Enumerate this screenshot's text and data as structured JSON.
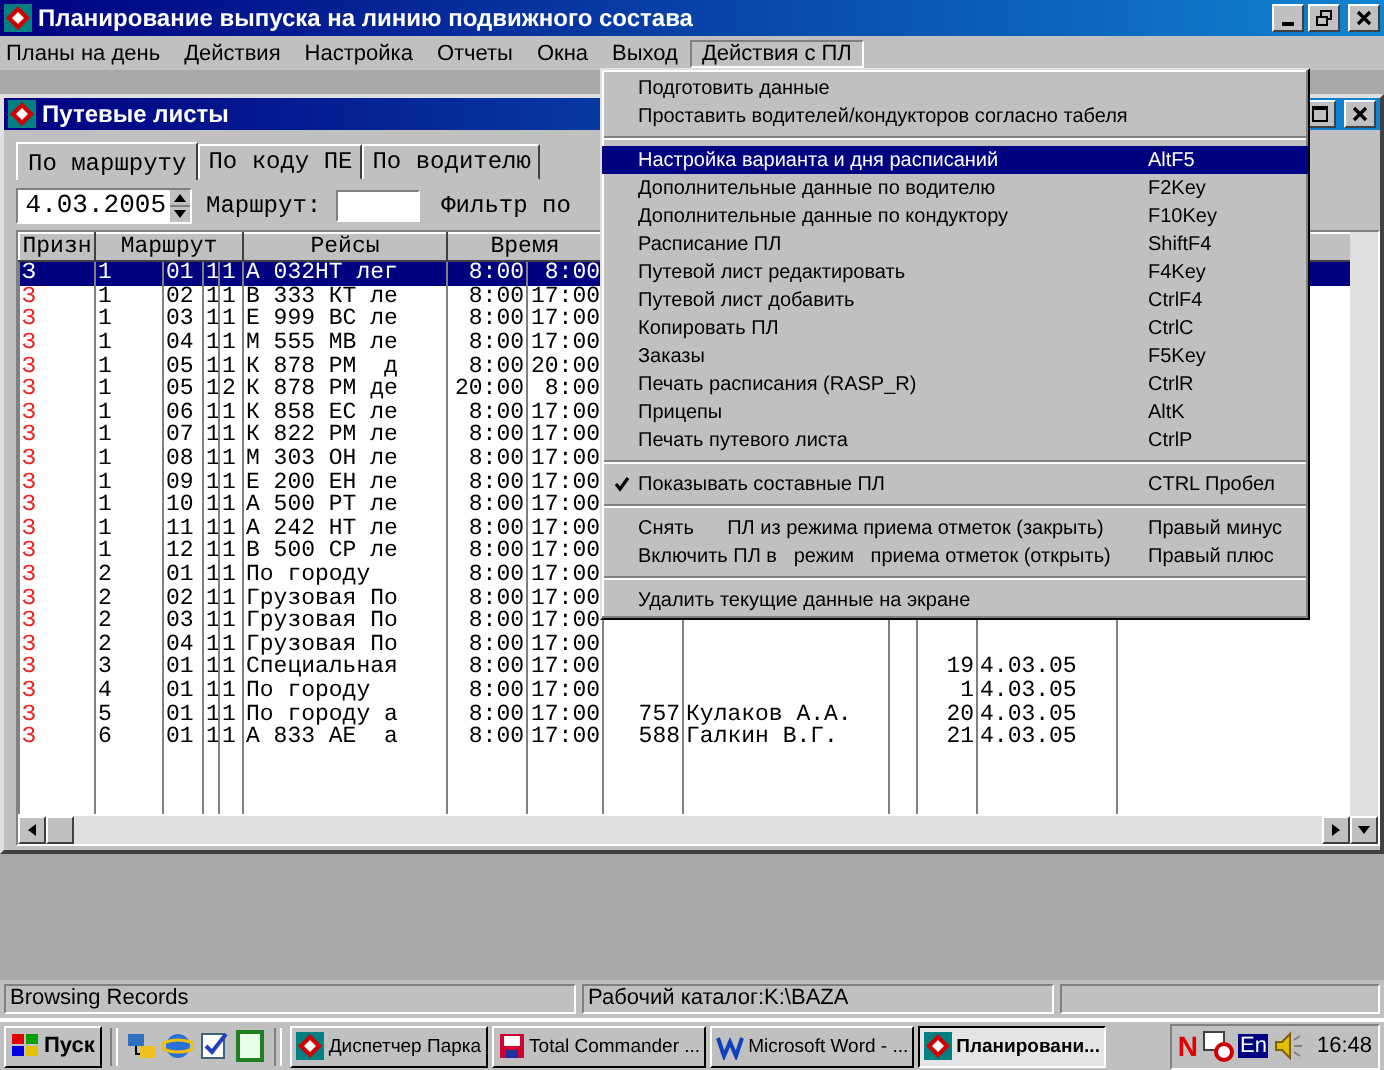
{
  "window": {
    "title": "Планирование выпуска на линию подвижного состава"
  },
  "menu_bar": [
    {
      "label": "Планы на день",
      "selected": false
    },
    {
      "label": "Действия",
      "selected": false
    },
    {
      "label": "Настройка",
      "selected": false
    },
    {
      "label": "Отчеты",
      "selected": false
    },
    {
      "label": "Окна",
      "selected": false
    },
    {
      "label": "Выход",
      "selected": false
    },
    {
      "label": "Действия с ПЛ",
      "selected": true
    }
  ],
  "child_window": {
    "title": "Путевые листы"
  },
  "tabs": [
    {
      "label": "По маршруту",
      "selected": true
    },
    {
      "label": "По коду ПЕ",
      "selected": false
    },
    {
      "label": "По водителю",
      "selected": false
    }
  ],
  "filter": {
    "date": "4.03.2005",
    "route_label": "Маршрут:",
    "filter_label": "Фильтр по"
  },
  "table": {
    "columns": [
      "Призн",
      "Маршрут",
      "Рейсы",
      "Время"
    ],
    "rows": [
      {
        "selected": true,
        "sign": "З",
        "route": [
          "1",
          "01",
          "1",
          "1"
        ],
        "trips": "А 032НТ лег",
        "time": [
          "8:00",
          "8:00"
        ]
      },
      {
        "selected": false,
        "sign": "З",
        "route": [
          "1",
          "02",
          "1",
          "1"
        ],
        "trips": "В 333 КТ ле",
        "time": [
          "8:00",
          "17:00"
        ]
      },
      {
        "selected": false,
        "sign": "З",
        "route": [
          "1",
          "03",
          "1",
          "1"
        ],
        "trips": "Е 999 ВС ле",
        "time": [
          "8:00",
          "17:00"
        ]
      },
      {
        "selected": false,
        "sign": "З",
        "route": [
          "1",
          "04",
          "1",
          "1"
        ],
        "trips": "М 555 МВ ле",
        "time": [
          "8:00",
          "17:00"
        ]
      },
      {
        "selected": false,
        "sign": "З",
        "route": [
          "1",
          "05",
          "1",
          "1"
        ],
        "trips": "К 878 РМ  д",
        "time": [
          "8:00",
          "20:00"
        ]
      },
      {
        "selected": false,
        "sign": "З",
        "route": [
          "1",
          "05",
          "1",
          "2"
        ],
        "trips": "К 878 РМ де",
        "time": [
          "20:00",
          "8:00"
        ]
      },
      {
        "selected": false,
        "sign": "З",
        "route": [
          "1",
          "06",
          "1",
          "1"
        ],
        "trips": "К 858 ЕС ле",
        "time": [
          "8:00",
          "17:00"
        ]
      },
      {
        "selected": false,
        "sign": "З",
        "route": [
          "1",
          "07",
          "1",
          "1"
        ],
        "trips": "К 822 РМ ле",
        "time": [
          "8:00",
          "17:00"
        ]
      },
      {
        "selected": false,
        "sign": "З",
        "route": [
          "1",
          "08",
          "1",
          "1"
        ],
        "trips": "М 303 ОН ле",
        "time": [
          "8:00",
          "17:00"
        ]
      },
      {
        "selected": false,
        "sign": "З",
        "route": [
          "1",
          "09",
          "1",
          "1"
        ],
        "trips": "Е 200 ЕН ле",
        "time": [
          "8:00",
          "17:00"
        ]
      },
      {
        "selected": false,
        "sign": "З",
        "route": [
          "1",
          "10",
          "1",
          "1"
        ],
        "trips": "А 500 РТ ле",
        "time": [
          "8:00",
          "17:00"
        ]
      },
      {
        "selected": false,
        "sign": "З",
        "route": [
          "1",
          "11",
          "1",
          "1"
        ],
        "trips": "А 242 НТ ле",
        "time": [
          "8:00",
          "17:00"
        ]
      },
      {
        "selected": false,
        "sign": "З",
        "route": [
          "1",
          "12",
          "1",
          "1"
        ],
        "trips": "В 500 СР ле",
        "time": [
          "8:00",
          "17:00"
        ]
      },
      {
        "selected": false,
        "sign": "З",
        "route": [
          "2",
          "01",
          "1",
          "1"
        ],
        "trips": "По городу",
        "time": [
          "8:00",
          "17:00"
        ]
      },
      {
        "selected": false,
        "sign": "З",
        "route": [
          "2",
          "02",
          "1",
          "1"
        ],
        "trips": "Грузовая По",
        "time": [
          "8:00",
          "17:00"
        ]
      },
      {
        "selected": false,
        "sign": "З",
        "route": [
          "2",
          "03",
          "1",
          "1"
        ],
        "trips": "Грузовая По",
        "time": [
          "8:00",
          "17:00"
        ]
      },
      {
        "selected": false,
        "sign": "З",
        "route": [
          "2",
          "04",
          "1",
          "1"
        ],
        "trips": "Грузовая По",
        "time": [
          "8:00",
          "17:00"
        ]
      },
      {
        "selected": false,
        "sign": "З",
        "route": [
          "3",
          "01",
          "1",
          "1"
        ],
        "trips": "Специальная",
        "time": [
          "8:00",
          "17:00"
        ],
        "column_12": "19",
        "column_13": "4.03.05"
      },
      {
        "selected": false,
        "sign": "З",
        "route": [
          "4",
          "01",
          "1",
          "1"
        ],
        "trips": "По городу",
        "time": [
          "8:00",
          "17:00"
        ],
        "column_12": "1",
        "column_13": "4.03.05"
      },
      {
        "selected": false,
        "sign": "З",
        "route": [
          "5",
          "01",
          "1",
          "1"
        ],
        "trips": "По городу а",
        "time": [
          "8:00",
          "17:00"
        ],
        "column_9": "757",
        "column_10": "Кулаков А.А.",
        "column_12": "20",
        "column_13": "4.03.05"
      },
      {
        "selected": false,
        "sign": "З",
        "route": [
          "6",
          "01",
          "1",
          "1"
        ],
        "trips": "А 833 АЕ  а",
        "time": [
          "8:00",
          "17:00"
        ],
        "column_9": "588",
        "column_10": "Галкин В.Г.",
        "column_12": "21",
        "column_13": "4.03.05"
      }
    ]
  },
  "dropdown_menu": [
    {
      "kind": "item",
      "label": "Подготовить данные",
      "selected": false,
      "checked": false
    },
    {
      "kind": "item",
      "label": "Проставить водителей/кондукторов согласно табеля",
      "selected": false,
      "checked": false
    },
    {
      "kind": "separator"
    },
    {
      "kind": "item",
      "label": "Настройка варианта и дня расписаний",
      "shortcut": "AltF5",
      "selected": true,
      "checked": false
    },
    {
      "kind": "item",
      "label": "Дополнительные данные по водителю",
      "shortcut": "F2Key",
      "selected": false,
      "checked": false
    },
    {
      "kind": "item",
      "label": "Дополнительные данные по кондуктору",
      "shortcut": "F10Key",
      "selected": false,
      "checked": false
    },
    {
      "kind": "item",
      "label": "Расписание ПЛ",
      "shortcut": "ShiftF4",
      "selected": false,
      "checked": false
    },
    {
      "kind": "item",
      "label": "Путевой лист редактировать",
      "shortcut": "F4Key",
      "selected": false,
      "checked": false
    },
    {
      "kind": "item",
      "label": "Путевой лист добавить",
      "shortcut": "CtrlF4",
      "selected": false,
      "checked": false
    },
    {
      "kind": "item",
      "label": "Копировать ПЛ",
      "shortcut": "CtrlC",
      "selected": false,
      "checked": false
    },
    {
      "kind": "item",
      "label": "Заказы",
      "shortcut": "F5Key",
      "selected": false,
      "checked": false
    },
    {
      "kind": "item",
      "label": "Печать расписания (RASP_R)",
      "shortcut": "CtrlR",
      "selected": false,
      "checked": false
    },
    {
      "kind": "item",
      "label": "Прицепы",
      "shortcut": "AltK",
      "selected": false,
      "checked": false
    },
    {
      "kind": "item",
      "label": "Печать путевого листа",
      "shortcut": "CtrlP",
      "selected": false,
      "checked": false
    },
    {
      "kind": "separator"
    },
    {
      "kind": "item",
      "label": "Показывать составные ПЛ",
      "shortcut": "CTRL Пробел",
      "selected": false,
      "checked": true
    },
    {
      "kind": "separator"
    },
    {
      "kind": "item",
      "label": "Снять      ПЛ из режима приема отметок (закрыть)",
      "shortcut": "Правый минус",
      "selected": false,
      "checked": false
    },
    {
      "kind": "item",
      "label": "Включить ПЛ в   режим   приема отметок (открыть)",
      "shortcut": "Правый плюс",
      "selected": false,
      "checked": false
    },
    {
      "kind": "separator"
    },
    {
      "kind": "item",
      "label": "Удалить текущие данные на экране",
      "selected": false,
      "checked": false
    }
  ],
  "status_bar": [
    "Browsing Records",
    "Рабочий каталог:K:\\BAZA"
  ],
  "taskbar": {
    "start": "Пуск",
    "tasks": [
      {
        "label": "Диспетчер Парка",
        "selected": false
      },
      {
        "label": "Total Commander ...",
        "selected": false
      },
      {
        "label": "Microsoft Word - ...",
        "selected": false
      },
      {
        "label": "Планировани...",
        "selected": true
      }
    ],
    "tray": {
      "badge": "N",
      "language": "En",
      "clock": "16:48"
    }
  }
}
